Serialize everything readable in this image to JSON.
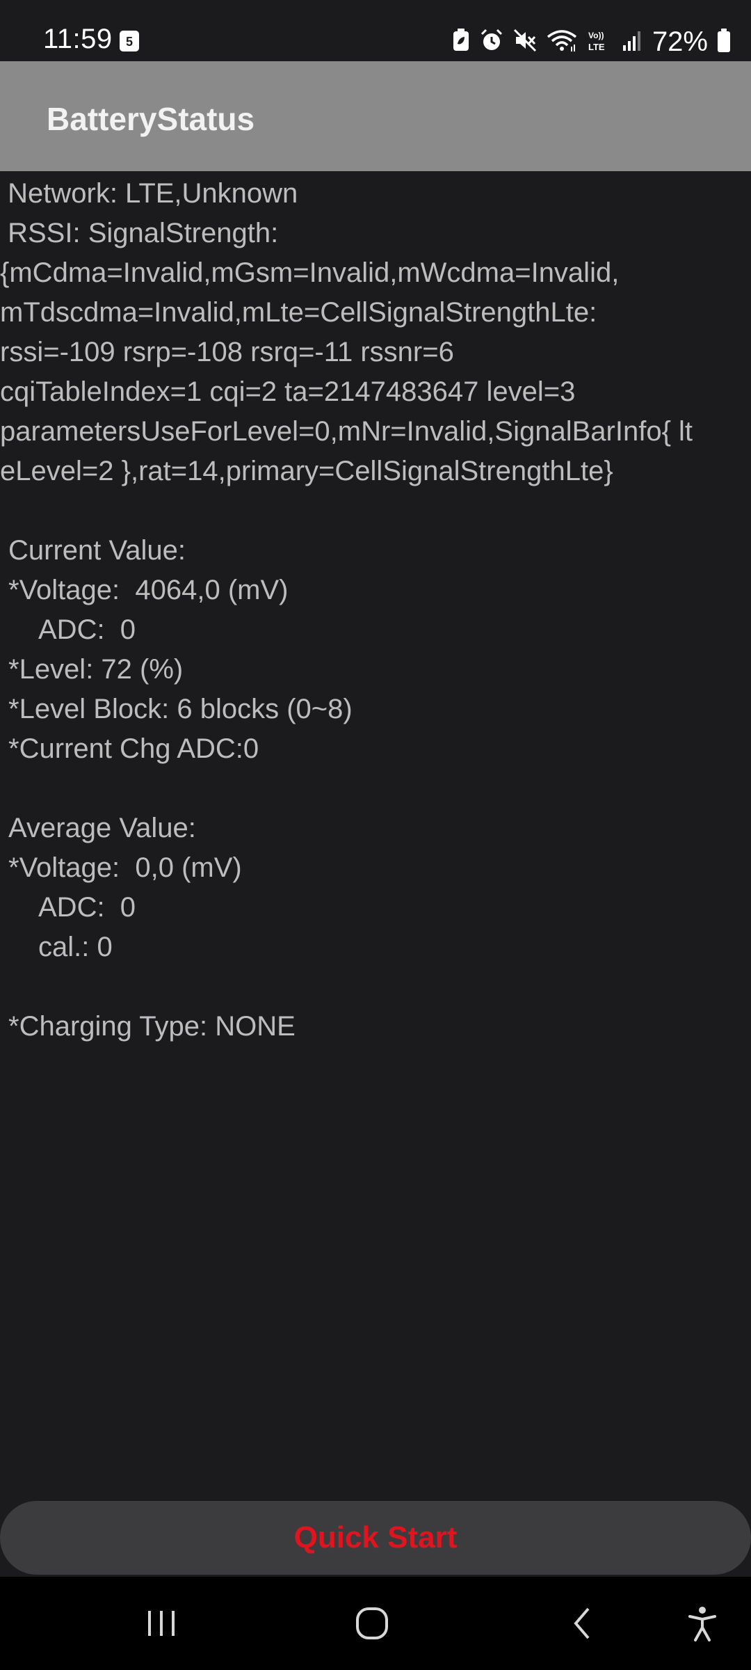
{
  "status_bar": {
    "time": "11:59",
    "calendar_day": "5",
    "battery_percent": "72%",
    "icons": [
      "calendar-icon",
      "battery-saver-icon",
      "alarm-icon",
      "mute-icon",
      "wifi-icon",
      "volte-icon",
      "signal-icon",
      "battery-icon"
    ]
  },
  "app_bar": {
    "title": "BatteryStatus"
  },
  "info": {
    "network": " Network: LTE,Unknown",
    "rssi_label": " RSSI: SignalStrength:",
    "signal_lines": [
      "{mCdma=Invalid,mGsm=Invalid,mWcdma=Invalid,",
      "mTdscdma=Invalid,mLte=CellSignalStrengthLte:",
      "rssi=-109 rsrp=-108 rsrq=-11 rssnr=6",
      "cqiTableIndex=1 cqi=2 ta=2147483647 level=3",
      "parametersUseForLevel=0,mNr=Invalid,SignalBarInfo{ lt",
      "eLevel=2 },rat=14,primary=CellSignalStrengthLte}"
    ],
    "current_header": "Current Value:",
    "current_voltage": "*Voltage:  4064,0 (mV)",
    "current_adc": "ADC:  0",
    "current_level": "*Level: 72 (%)",
    "current_level_block": "*Level Block: 6 blocks (0~8)",
    "current_chg_adc": "*Current Chg ADC:0",
    "average_header": "Average Value:",
    "average_voltage": "*Voltage:  0,0 (mV)",
    "average_adc": "ADC:  0",
    "average_cal": "cal.: 0",
    "charging_type": "*Charging Type: NONE"
  },
  "quick_start": {
    "label": "Quick Start",
    "color": "#e0141e"
  },
  "nav_bar": {
    "icons": [
      "recent-apps-icon",
      "home-icon",
      "back-icon",
      "accessibility-icon"
    ]
  }
}
